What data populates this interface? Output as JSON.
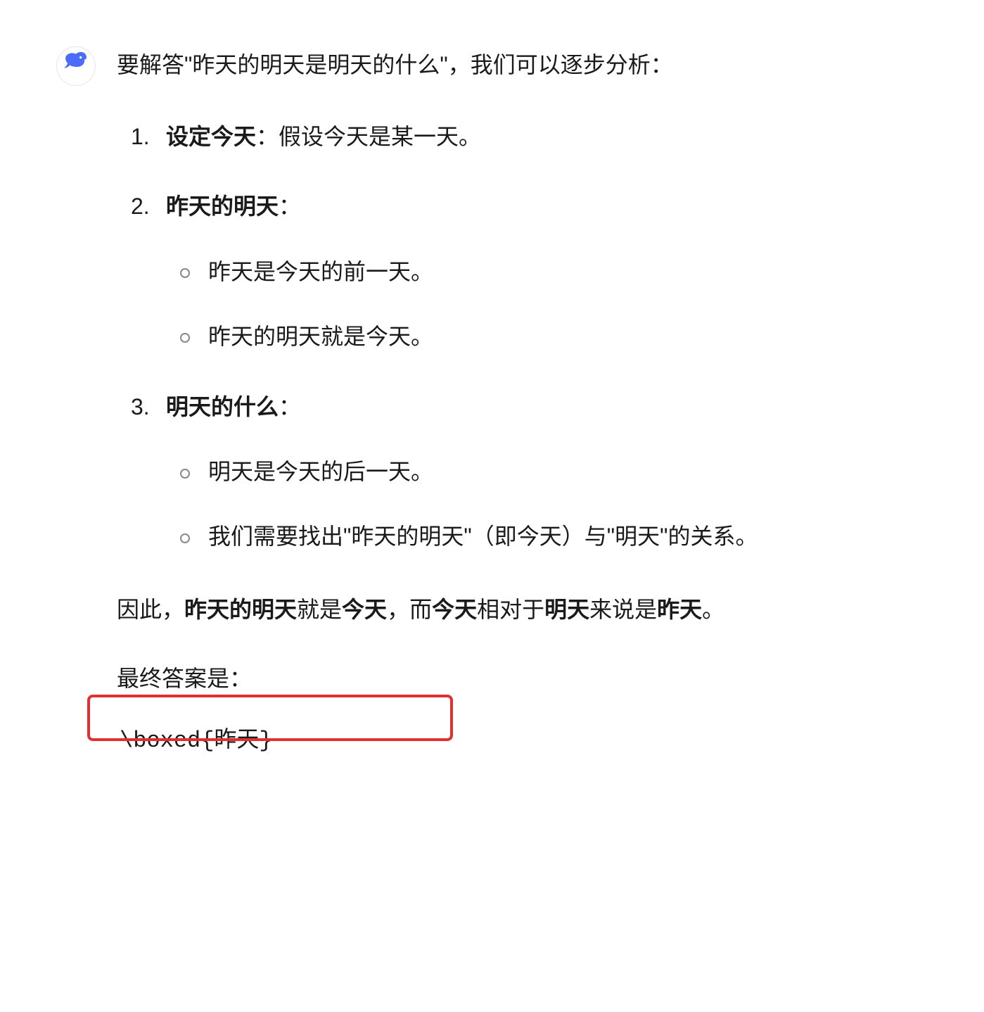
{
  "intro": "要解答\"昨天的明天是明天的什么\"，我们可以逐步分析：",
  "steps": [
    {
      "title_bold": "设定今天",
      "title_rest": "：假设今天是某一天。",
      "subs": []
    },
    {
      "title_bold": "昨天的明天",
      "title_rest": "：",
      "subs": [
        "昨天是今天的前一天。",
        "昨天的明天就是今天。"
      ]
    },
    {
      "title_bold": "明天的什么",
      "title_rest": "：",
      "subs": [
        "明天是今天的后一天。",
        "我们需要找出\"昨天的明天\"（即今天）与\"明天\"的关系。"
      ]
    }
  ],
  "conclusion": {
    "p1": "因此，",
    "b1": "昨天的明天",
    "p2": "就是",
    "b2": "今天",
    "p3": "，而",
    "b3": "今天",
    "p4": "相对于",
    "b4": "明天",
    "p5": "来说是",
    "b5": "昨天",
    "p6": "。"
  },
  "final_label": "最终答案是：",
  "final_answer": "\\boxed{昨天}"
}
